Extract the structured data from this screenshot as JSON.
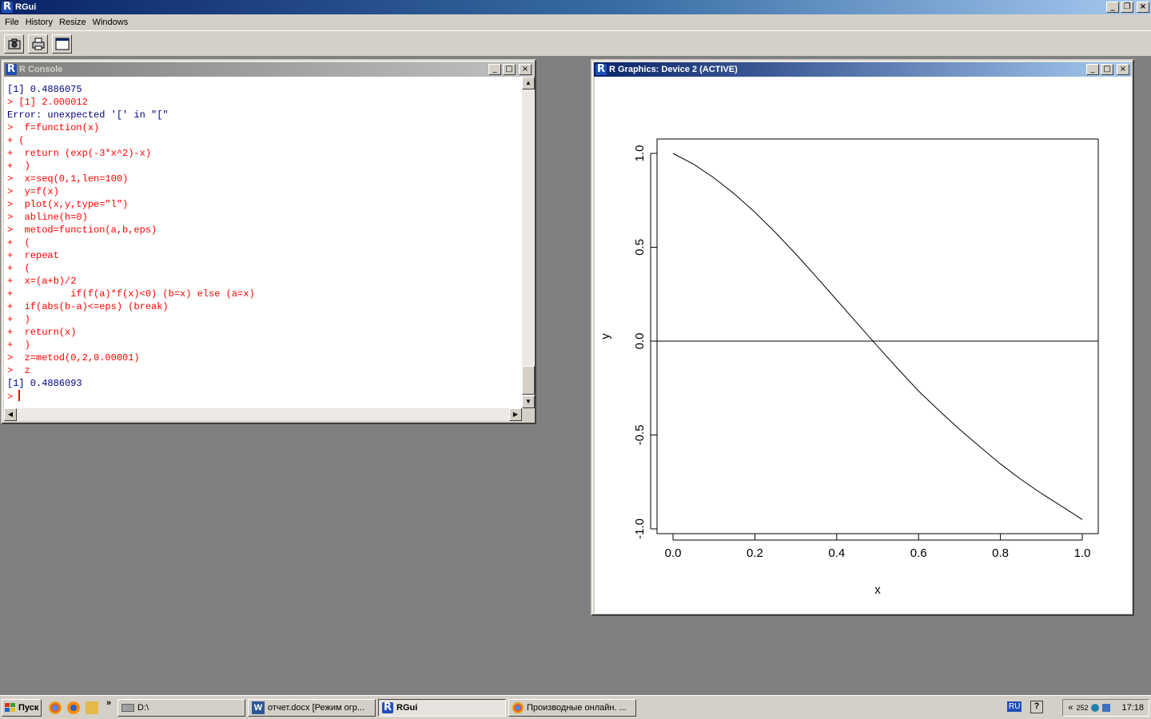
{
  "app": {
    "title": "RGui"
  },
  "menu": [
    "File",
    "History",
    "Resize",
    "Windows"
  ],
  "toolbar": {
    "icons": [
      "camera-icon",
      "print-icon",
      "window-icon"
    ]
  },
  "console_window": {
    "title": "R Console",
    "lines": [
      {
        "t": "out",
        "text": "[1] 0.4886075"
      },
      {
        "t": "in",
        "text": "> [1] 2.000012"
      },
      {
        "t": "out",
        "text": "Error: unexpected '[' in \"[\""
      },
      {
        "t": "in",
        "text": ">  f=function(x)"
      },
      {
        "t": "in",
        "text": "+ ("
      },
      {
        "t": "in",
        "text": "+  return (exp(-3*x^2)-x)"
      },
      {
        "t": "in",
        "text": "+  )"
      },
      {
        "t": "in",
        "text": ">  x=seq(0,1,len=100)"
      },
      {
        "t": "in",
        "text": ">  y=f(x)"
      },
      {
        "t": "in",
        "text": ">  plot(x,y,type=\"l\")"
      },
      {
        "t": "in",
        "text": ">  abline(h=0)"
      },
      {
        "t": "in",
        "text": ">  metod=function(a,b,eps)"
      },
      {
        "t": "in",
        "text": "+  ("
      },
      {
        "t": "in",
        "text": "+  repeat"
      },
      {
        "t": "in",
        "text": "+  ("
      },
      {
        "t": "in",
        "text": "+  x=(a+b)/2"
      },
      {
        "t": "in",
        "text": "+          if(f(a)*f(x)<0) (b=x) else (a=x)"
      },
      {
        "t": "in",
        "text": "+  if(abs(b-a)<=eps) (break)"
      },
      {
        "t": "in",
        "text": "+  )"
      },
      {
        "t": "in",
        "text": "+  return(x)"
      },
      {
        "t": "in",
        "text": "+  )"
      },
      {
        "t": "in",
        "text": ">  z=metod(0,2,0.00001)"
      },
      {
        "t": "in",
        "text": ">  z"
      },
      {
        "t": "out",
        "text": "[1] 0.4886093"
      }
    ],
    "prompt": "> "
  },
  "graphics_window": {
    "title": "R Graphics: Device 2 (ACTIVE)"
  },
  "chart_data": {
    "type": "line",
    "xlabel": "x",
    "ylabel": "y",
    "xlim": [
      0,
      1
    ],
    "ylim": [
      -1,
      1
    ],
    "x_ticks": [
      "0.0",
      "0.2",
      "0.4",
      "0.6",
      "0.8",
      "1.0"
    ],
    "y_ticks": [
      "-1.0",
      "-0.5",
      "0.0",
      "0.5",
      "1.0"
    ],
    "series": [
      {
        "x": [
          0,
          0.05,
          0.1,
          0.15,
          0.2,
          0.25,
          0.3,
          0.35,
          0.4,
          0.45,
          0.5,
          0.55,
          0.6,
          0.65,
          0.7,
          0.75,
          0.8,
          0.85,
          0.9,
          0.95,
          1.0
        ],
        "values": [
          1.0,
          0.943,
          0.87,
          0.784,
          0.687,
          0.579,
          0.464,
          0.343,
          0.219,
          0.095,
          -0.028,
          -0.149,
          -0.266,
          -0.37,
          -0.47,
          -0.563,
          -0.654,
          -0.736,
          -0.811,
          -0.88,
          -0.95
        ]
      }
    ],
    "hline": 0,
    "grid": false
  },
  "taskbar": {
    "start": "Пуск",
    "tasks": [
      {
        "label": "D:\\",
        "pressed": false
      },
      {
        "label": "отчет.docx [Режим огр...",
        "pressed": false
      },
      {
        "label": "RGui",
        "pressed": true
      },
      {
        "label": "Производные онлайн. ...",
        "pressed": false
      }
    ],
    "lang": "RU",
    "clock": "17:18",
    "tray_num": "252"
  }
}
